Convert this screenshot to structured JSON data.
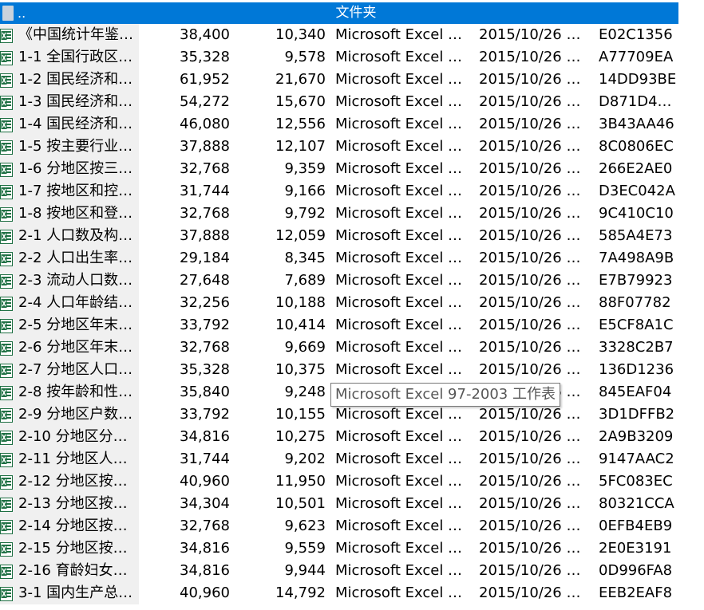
{
  "parent_row": {
    "name": "..",
    "type": "文件夹"
  },
  "rows": [
    {
      "name": "《中国统计年鉴…",
      "size": "38,400",
      "packed": "10,340",
      "type": "Microsoft Excel 9…",
      "date": "2015/10/26 1…",
      "crc": "E02C1356"
    },
    {
      "name": "1-1  全国行政区…",
      "size": "35,328",
      "packed": "9,578",
      "type": "Microsoft Excel 9…",
      "date": "2015/10/26 1…",
      "crc": "A77709EA"
    },
    {
      "name": "1-2  国民经济和…",
      "size": "61,952",
      "packed": "21,670",
      "type": "Microsoft Excel 9…",
      "date": "2015/10/26 1…",
      "crc": "14DD93BE"
    },
    {
      "name": "1-3  国民经济和…",
      "size": "54,272",
      "packed": "15,670",
      "type": "Microsoft Excel 9…",
      "date": "2015/10/26 1…",
      "crc": "D871D4…"
    },
    {
      "name": "1-4  国民经济和…",
      "size": "46,080",
      "packed": "12,556",
      "type": "Microsoft Excel 9…",
      "date": "2015/10/26 1…",
      "crc": "3B43AA46"
    },
    {
      "name": "1-5  按主要行业…",
      "size": "37,888",
      "packed": "12,107",
      "type": "Microsoft Excel 9…",
      "date": "2015/10/26 1…",
      "crc": "8C0806EC"
    },
    {
      "name": "1-6  分地区按三…",
      "size": "32,768",
      "packed": "9,359",
      "type": "Microsoft Excel 9…",
      "date": "2015/10/26 1…",
      "crc": "266E2AE0"
    },
    {
      "name": "1-7  按地区和控…",
      "size": "31,744",
      "packed": "9,166",
      "type": "Microsoft Excel 9…",
      "date": "2015/10/26 1…",
      "crc": "D3EC042A"
    },
    {
      "name": "1-8  按地区和登…",
      "size": "32,768",
      "packed": "9,792",
      "type": "Microsoft Excel 9…",
      "date": "2015/10/26 1…",
      "crc": "9C410C10"
    },
    {
      "name": "2-1  人口数及构…",
      "size": "37,888",
      "packed": "12,059",
      "type": "Microsoft Excel 9…",
      "date": "2015/10/26 1…",
      "crc": "585A4E73"
    },
    {
      "name": "2-2  人口出生率…",
      "size": "29,184",
      "packed": "8,345",
      "type": "Microsoft Excel 9…",
      "date": "2015/10/26 1…",
      "crc": "7A498A9B"
    },
    {
      "name": "2-3  流动人口数…",
      "size": "27,648",
      "packed": "7,689",
      "type": "Microsoft Excel 9…",
      "date": "2015/10/26 1…",
      "crc": "E7B79923"
    },
    {
      "name": "2-4  人口年龄结…",
      "size": "32,256",
      "packed": "10,188",
      "type": "Microsoft Excel 9…",
      "date": "2015/10/26 1…",
      "crc": "88F07782"
    },
    {
      "name": "2-5  分地区年末…",
      "size": "33,792",
      "packed": "10,414",
      "type": "Microsoft Excel 9…",
      "date": "2015/10/26 1…",
      "crc": "E5CF8A1C"
    },
    {
      "name": "2-6  分地区年末…",
      "size": "32,768",
      "packed": "9,669",
      "type": "Microsoft Excel 9…",
      "date": "2015/10/26 1…",
      "crc": "3328C2B7"
    },
    {
      "name": "2-7  分地区人口…",
      "size": "35,328",
      "packed": "10,375",
      "type": "Microsoft Excel 9…",
      "date": "2015/10/26 1…",
      "crc": "136D1236"
    },
    {
      "name": "2-8  按年龄和性…",
      "size": "35,840",
      "packed": "9,248",
      "type": "Microsoft Excel 9…",
      "date": "2015/10/26 1…",
      "crc": "845EAF04"
    },
    {
      "name": "2-9  分地区户数…",
      "size": "33,792",
      "packed": "10,155",
      "type": "Microsoft Excel 9…",
      "date": "2015/10/26 1…",
      "crc": "3D1DFFB2"
    },
    {
      "name": "2-10  分地区分…",
      "size": "34,816",
      "packed": "10,275",
      "type": "Microsoft Excel 9…",
      "date": "2015/10/26 1…",
      "crc": "2A9B3209"
    },
    {
      "name": "2-11  分地区人…",
      "size": "31,744",
      "packed": "9,202",
      "type": "Microsoft Excel 9…",
      "date": "2015/10/26 1…",
      "crc": "9147AAC2"
    },
    {
      "name": "2-12  分地区按…",
      "size": "40,960",
      "packed": "11,950",
      "type": "Microsoft Excel 9…",
      "date": "2015/10/26 1…",
      "crc": "5FC083EC"
    },
    {
      "name": "2-13  分地区按…",
      "size": "34,304",
      "packed": "10,501",
      "type": "Microsoft Excel 9…",
      "date": "2015/10/26 1…",
      "crc": "80321CCA"
    },
    {
      "name": "2-14  分地区按…",
      "size": "32,768",
      "packed": "9,623",
      "type": "Microsoft Excel 9…",
      "date": "2015/10/26 1…",
      "crc": "0EFB4EB9"
    },
    {
      "name": "2-15  分地区按…",
      "size": "34,816",
      "packed": "9,559",
      "type": "Microsoft Excel 9…",
      "date": "2015/10/26 1…",
      "crc": "2E0E3191"
    },
    {
      "name": "2-16  育龄妇女…",
      "size": "34,816",
      "packed": "9,944",
      "type": "Microsoft Excel 9…",
      "date": "2015/10/26 1…",
      "crc": "0D996FA8"
    },
    {
      "name": "3-1  国内生产总…",
      "size": "40,960",
      "packed": "14,792",
      "type": "Microsoft Excel 9…",
      "date": "2015/10/26 1…",
      "crc": "EEB2EAF8"
    }
  ],
  "tooltip": {
    "text": "Microsoft Excel 97-2003 工作表"
  },
  "colors": {
    "selection": "#0078d7",
    "excel_green": "#1d6f42",
    "name_column_bg": "#f0f0f0"
  },
  "icons": {
    "parent": "folder-up-icon",
    "file": "excel-file-icon"
  }
}
